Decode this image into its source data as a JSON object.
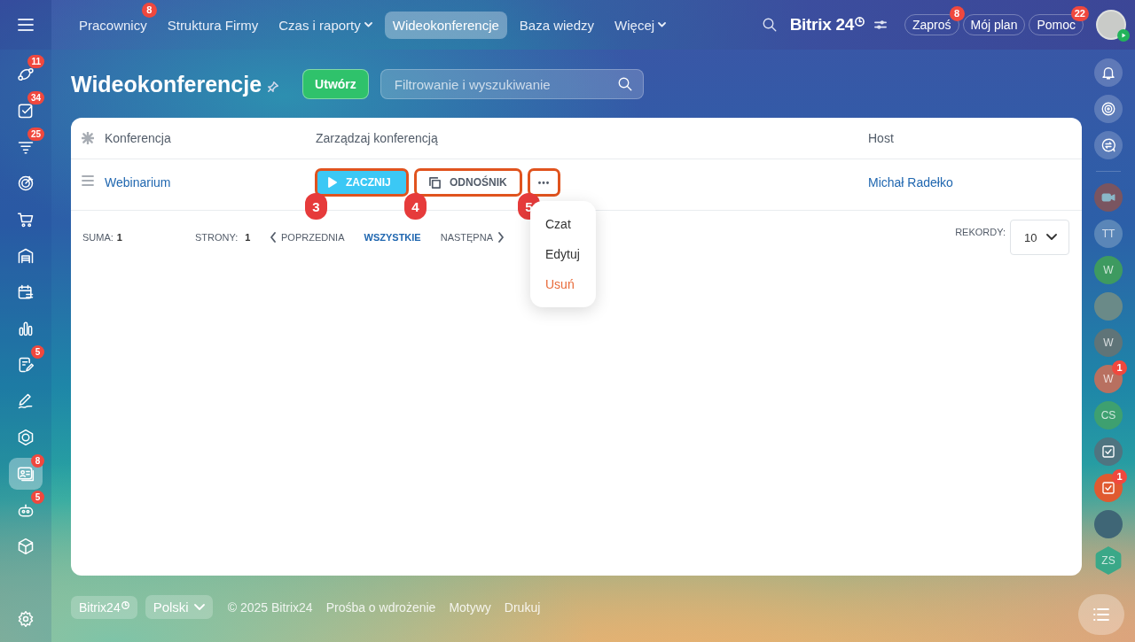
{
  "top_nav": {
    "tabs": [
      {
        "label": "Pracownicy",
        "selected": false,
        "badge": "8",
        "dropdown": false
      },
      {
        "label": "Struktura Firmy",
        "selected": false,
        "dropdown": false
      },
      {
        "label": "Czas i raporty",
        "selected": false,
        "dropdown": true
      },
      {
        "label": "Wideokonferencje",
        "selected": true,
        "dropdown": false
      },
      {
        "label": "Baza wiedzy",
        "selected": false,
        "dropdown": false
      },
      {
        "label": "Więcej",
        "selected": false,
        "dropdown": true
      }
    ],
    "logo": "Bitrix 24",
    "buttons": [
      {
        "label": "Zaproś",
        "badge": "8"
      },
      {
        "label": "Mój plan"
      },
      {
        "label": "Pomoc",
        "badge": "22"
      }
    ]
  },
  "left_sidebar": {
    "items": [
      {
        "kind": "nodes",
        "badge": "11",
        "selected": false
      },
      {
        "kind": "checkbox",
        "badge": "34",
        "selected": false
      },
      {
        "kind": "funnel",
        "badge": "25",
        "selected": false
      },
      {
        "kind": "target",
        "selected": false
      },
      {
        "kind": "cart",
        "selected": false
      },
      {
        "kind": "warehouse",
        "selected": false
      },
      {
        "kind": "calendar",
        "selected": false
      },
      {
        "kind": "chart",
        "selected": false
      },
      {
        "kind": "document",
        "badge": "5",
        "selected": false
      },
      {
        "kind": "pen",
        "selected": false
      },
      {
        "kind": "hexagon",
        "selected": false
      },
      {
        "kind": "card",
        "badge": "8",
        "selected": true
      },
      {
        "kind": "robot",
        "badge": "5",
        "selected": false
      },
      {
        "kind": "box",
        "selected": false
      }
    ]
  },
  "right_sidebar": {
    "items": [
      {
        "kind": "bell"
      },
      {
        "kind": "disc"
      },
      {
        "kind": "chat"
      },
      {
        "kind": "divider"
      },
      {
        "kind": "video",
        "color": "#7a5560"
      },
      {
        "kind": "initials",
        "initials": "TT",
        "color": "#5a86b8"
      },
      {
        "kind": "initials",
        "initials": "W",
        "color": "#3e9a60"
      },
      {
        "kind": "photo",
        "color": "#6a8a88"
      },
      {
        "kind": "initials",
        "initials": "W",
        "color": "#5f7478"
      },
      {
        "kind": "initials",
        "initials": "W",
        "color": "#b87060",
        "badge": "1"
      },
      {
        "kind": "initials",
        "initials": "CS",
        "color": "#3ea070"
      },
      {
        "kind": "task",
        "color": "#4f7480"
      },
      {
        "kind": "task",
        "color": "#e05a30",
        "badge": "1"
      },
      {
        "kind": "photo",
        "color": "#3f6676"
      },
      {
        "kind": "hex",
        "initials": "ZS",
        "color": "#3aa888"
      }
    ]
  },
  "page": {
    "title": "Wideokonferencje",
    "create_button": "Utwórz",
    "filter": {
      "placeholder": "Filtrowanie i wyszukiwanie"
    }
  },
  "table": {
    "columns": [
      "Konferencja",
      "Zarządzaj konferencją",
      "Host"
    ],
    "rows": [
      {
        "name": "Webinarium",
        "host": "Michał Radełko",
        "actions": [
          {
            "kind": "start",
            "label": "ZACZNIJ",
            "highlighted": true,
            "marker": "3"
          },
          {
            "kind": "link",
            "label": "ODNOŚNIK",
            "highlighted": true,
            "marker": "4"
          },
          {
            "kind": "more",
            "label": "•••",
            "highlighted": true,
            "marker": "5"
          }
        ]
      }
    ],
    "menu": [
      {
        "label": "Czat",
        "kind": "normal"
      },
      {
        "label": "Edytuj",
        "kind": "normal"
      },
      {
        "label": "Usuń",
        "kind": "danger"
      }
    ],
    "footer": {
      "total_label": "SUMA:",
      "total": "1",
      "pages_label": "STRONY:",
      "pages": "1",
      "pager": [
        {
          "label": "POPRZEDNIA",
          "kind": "prev",
          "selected": false
        },
        {
          "label": "WSZYSTKIE",
          "kind": "all",
          "selected": true
        },
        {
          "label": "NASTĘPNA",
          "kind": "next",
          "selected": false
        }
      ],
      "records_label": "REKORDY:",
      "records": "10"
    }
  },
  "footer": {
    "logo_button": "Bitrix24",
    "language": "Polski",
    "copyright": "© 2025 Bitrix24",
    "links": [
      "Prośba o wdrożenie",
      "Motywy",
      "Drukuj"
    ]
  }
}
